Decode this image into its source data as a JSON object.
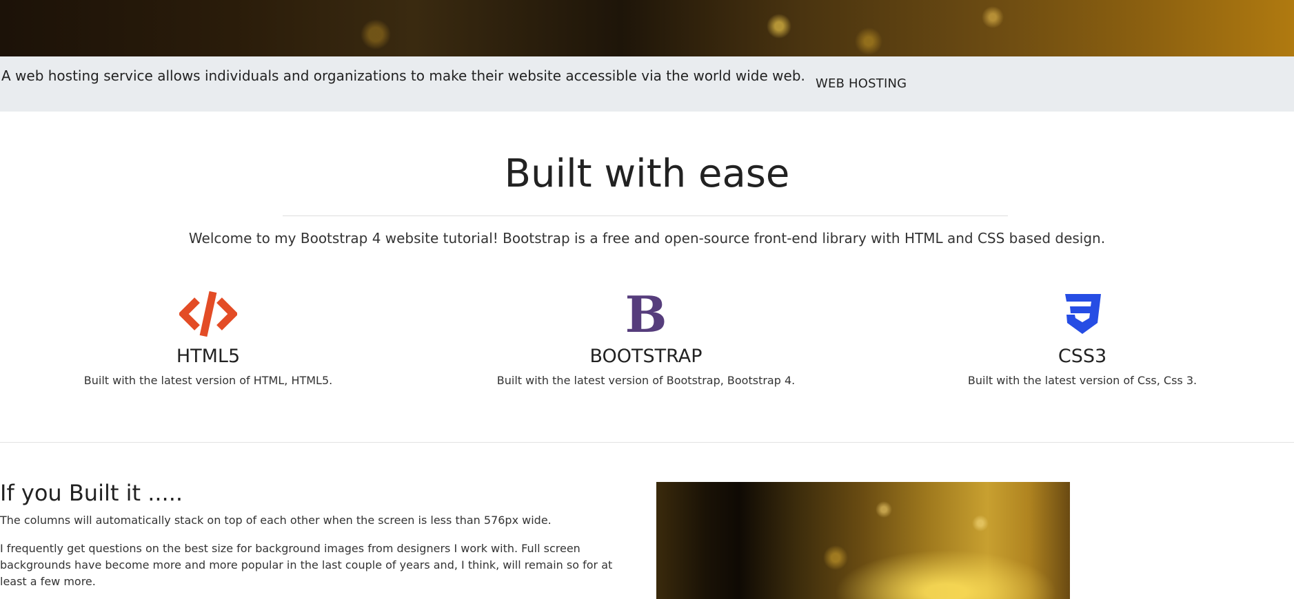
{
  "info_bar": {
    "text": "A web hosting service allows individuals and organizations to make their website accessible via the world wide web.",
    "link_label": "WEB HOSTING"
  },
  "intro": {
    "title": "Built with ease",
    "lead": "Welcome to my Bootstrap 4 website tutorial! Bootstrap is a free and open-source front-end library with HTML and CSS based design."
  },
  "features": [
    {
      "icon": "html5-code-icon",
      "name": "HTML5",
      "desc": "Built with the latest version of HTML, HTML5.",
      "color": "#e34c26"
    },
    {
      "icon": "bootstrap-icon",
      "name": "BOOTSTRAP",
      "desc": "Built with the latest version of Bootstrap, Bootstrap 4.",
      "color": "#563d7c"
    },
    {
      "icon": "css3-icon",
      "name": "CSS3",
      "desc": "Built with the latest version of Css, Css 3.",
      "color": "#264de4"
    }
  ],
  "bottom": {
    "title": "If you Built it .....",
    "p1": "The columns will automatically stack on top of each other when the screen is less than 576px wide.",
    "p2": "I frequently get questions on the best size for background images from designers I work with. Full screen backgrounds have become more and more popular in the last couple of years and, I think, will remain so for at least a few more."
  }
}
